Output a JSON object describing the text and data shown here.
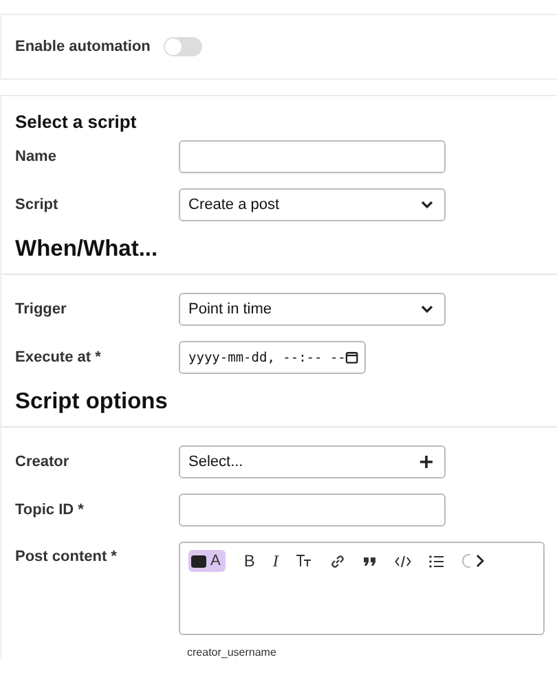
{
  "automation": {
    "label": "Enable automation",
    "on": false
  },
  "sections": [
    {
      "title": "Select a script",
      "kind": "small",
      "fields": [
        {
          "label": "Name",
          "kind": "text"
        },
        {
          "label": "Script",
          "kind": "select",
          "value": "Create a post"
        }
      ]
    },
    {
      "title": "When/What...",
      "kind": "large",
      "fields": [
        {
          "label": "Trigger",
          "kind": "select",
          "value": "Point in time"
        },
        {
          "label": "Execute at *",
          "kind": "datetime",
          "value": "yyyy-mm-dd, --:-- --"
        }
      ]
    },
    {
      "title": "Script options",
      "kind": "large",
      "fields": [
        {
          "label": "Creator",
          "kind": "chooser",
          "value": "Select..."
        },
        {
          "label": "Topic ID *",
          "kind": "text"
        },
        {
          "label": "Post content *",
          "kind": "editor"
        }
      ]
    }
  ],
  "editor": {
    "mode_toggle": {
      "label": "A",
      "selected": true
    },
    "bold": "B",
    "italic": "I",
    "placeholder_hint": "creator_username"
  }
}
